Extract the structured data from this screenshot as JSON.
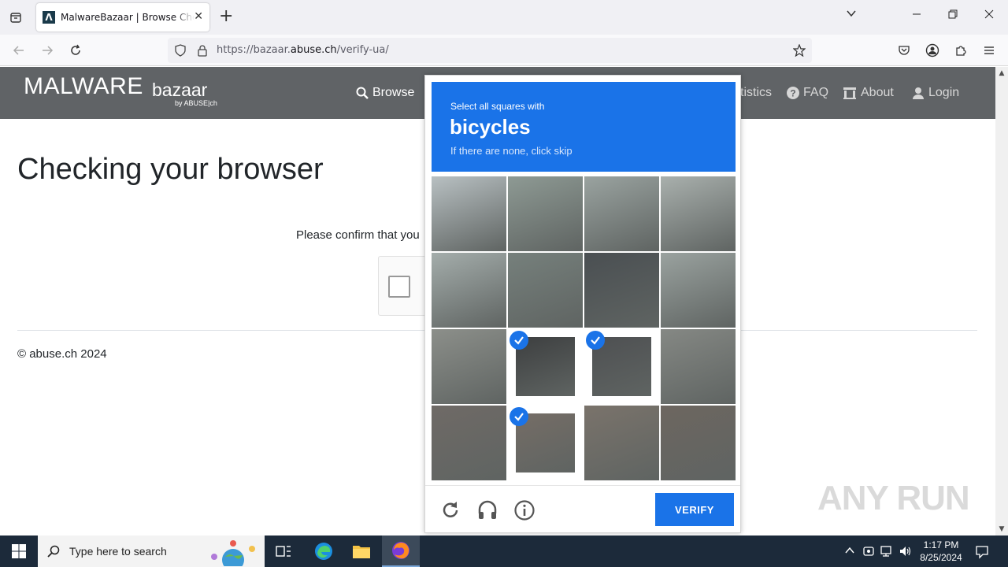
{
  "browser": {
    "tab_title": "MalwareBazaar | Browse Checking your browser",
    "url_prefix": "https://bazaar.",
    "url_domain": "abuse.ch",
    "url_suffix": "/verify-ua/"
  },
  "site": {
    "logo_main": "MALWARE",
    "logo_sub": "bazaar",
    "logo_by": "by ABUSE|ch",
    "menu": [
      {
        "label": "Browse",
        "icon": "search-icon"
      },
      {
        "label": "tistics",
        "icon": "chart-icon"
      },
      {
        "label": "FAQ",
        "icon": "question-icon"
      },
      {
        "label": "About",
        "icon": "building-icon"
      },
      {
        "label": "Login",
        "icon": "user-icon"
      }
    ],
    "page_title": "Checking your browser",
    "confirm_text": "Please confirm that you",
    "footer": "© abuse.ch 2024"
  },
  "captcha": {
    "instruction": "Select all squares with",
    "target": "bicycles",
    "hint": "If there are none, click skip",
    "verify_label": "VERIFY",
    "selected_cells": [
      9,
      10,
      13
    ],
    "accent": "#1a73e8"
  },
  "watermark": "ANY RUN",
  "taskbar": {
    "search_placeholder": "Type here to search",
    "time": "1:17 PM",
    "date": "8/25/2024"
  }
}
